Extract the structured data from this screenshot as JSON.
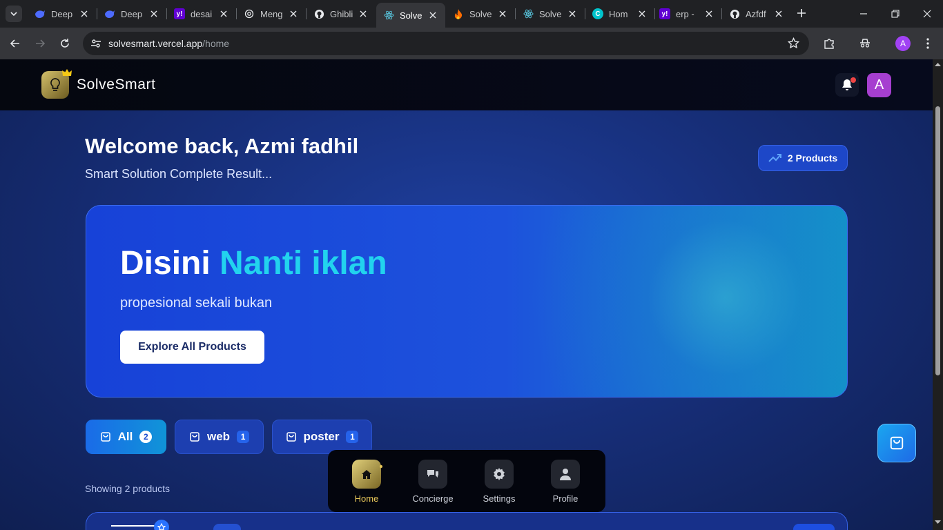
{
  "browser": {
    "tabs": [
      {
        "title": "Deep",
        "icon": "deepseek-icon",
        "color": "#4d6bfe"
      },
      {
        "title": "Deep",
        "icon": "deepseek-icon",
        "color": "#4d6bfe"
      },
      {
        "title": "desai",
        "icon": "yahoo-icon",
        "color": "#6001d2"
      },
      {
        "title": "Meng",
        "icon": "openai-icon",
        "color": "#e8eaed"
      },
      {
        "title": "Ghibli",
        "icon": "github-icon",
        "color": "#e8eaed"
      },
      {
        "title": "Solve",
        "icon": "react-icon",
        "color": "#58c4dc",
        "active": true
      },
      {
        "title": "Solve",
        "icon": "firebase-icon",
        "color": "#ff6d00"
      },
      {
        "title": "Solve",
        "icon": "react-icon",
        "color": "#58c4dc"
      },
      {
        "title": "Hom",
        "icon": "canva-icon",
        "color": "#00c4cc"
      },
      {
        "title": "erp -",
        "icon": "yahoo-icon",
        "color": "#6001d2"
      },
      {
        "title": "Azfdf",
        "icon": "github-icon",
        "color": "#e8eaed"
      }
    ],
    "url_host": "solvesmart.vercel.app",
    "url_path": "/home",
    "profile_initial": "A"
  },
  "app": {
    "brand": "SolveSmart",
    "user_initial": "A",
    "welcome": "Welcome back, Azmi fadhil",
    "subtitle": "Smart Solution Complete Result...",
    "products_pill": "2 Products",
    "hero": {
      "title_white": "Disini",
      "title_accent": "Nanti iklan",
      "subtitle": "propesional sekali bukan",
      "button": "Explore All Products"
    },
    "categories": [
      {
        "label": "All",
        "count": "2",
        "active": true
      },
      {
        "label": "web",
        "count": "1",
        "active": false
      },
      {
        "label": "poster",
        "count": "1",
        "active": false
      }
    ],
    "showing": "Showing 2 products",
    "nav": [
      {
        "label": "Home",
        "icon": "home-icon",
        "active": true
      },
      {
        "label": "Concierge",
        "icon": "chat-icon",
        "active": false
      },
      {
        "label": "Settings",
        "icon": "gear-icon",
        "active": false
      },
      {
        "label": "Profile",
        "icon": "user-icon",
        "active": false
      }
    ]
  }
}
